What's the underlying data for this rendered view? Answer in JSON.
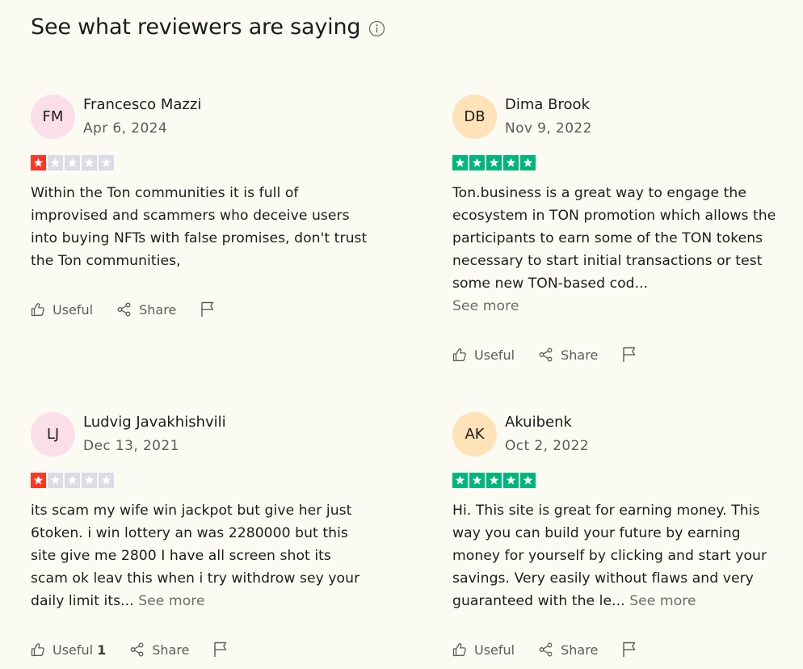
{
  "heading": {
    "title": "See what reviewers are saying",
    "info_icon": "info-circle-icon"
  },
  "colors": {
    "background": "#fcfbf3",
    "star_red": "#ff3722",
    "star_green": "#00b67a",
    "star_empty": "#dcdce6",
    "avatar_pink": "#fbdfe8",
    "avatar_peach": "#ffe3b8"
  },
  "reviews": [
    {
      "initials": "FM",
      "name": "Francesco Mazzi",
      "date": "Apr 6, 2024",
      "rating": 1,
      "text": "Within the Ton communities it is full of improvised and scammers who deceive users into buying NFTs with false promises, don't trust the Ton communities,",
      "see_more": "",
      "useful_label": "Useful",
      "useful_count": "",
      "share_label": "Share"
    },
    {
      "initials": "DB",
      "name": "Dima Brook",
      "date": "Nov 9, 2022",
      "rating": 5,
      "text": "Ton.business is a great way to engage the ecosystem in TON promotion which allows the participants to earn some of the TON tokens necessary to start initial transactions or test some new TON-based cod...",
      "see_more": "See more",
      "useful_label": "Useful",
      "useful_count": "",
      "share_label": "Share"
    },
    {
      "initials": "LJ",
      "name": "Ludvig Javakhishvili",
      "date": "Dec 13, 2021",
      "rating": 1,
      "text": "its scam my wife win jackpot but give her just 6token. i win lottery an was 2280000 but this site give me 2800 I have all screen shot its scam ok leav this when i try withdrow sey your daily limit its...",
      "see_more": "See more",
      "useful_label": "Useful",
      "useful_count": "1",
      "share_label": "Share"
    },
    {
      "initials": "AK",
      "name": "Akuibenk",
      "date": "Oct 2, 2022",
      "rating": 5,
      "text": "Hi. This site is great for earning money. This way you can build your future by earning money for yourself by clicking and start your savings. Very easily without flaws and very guaranteed with the le...",
      "see_more": "See more",
      "useful_label": "Useful",
      "useful_count": "",
      "share_label": "Share"
    }
  ]
}
